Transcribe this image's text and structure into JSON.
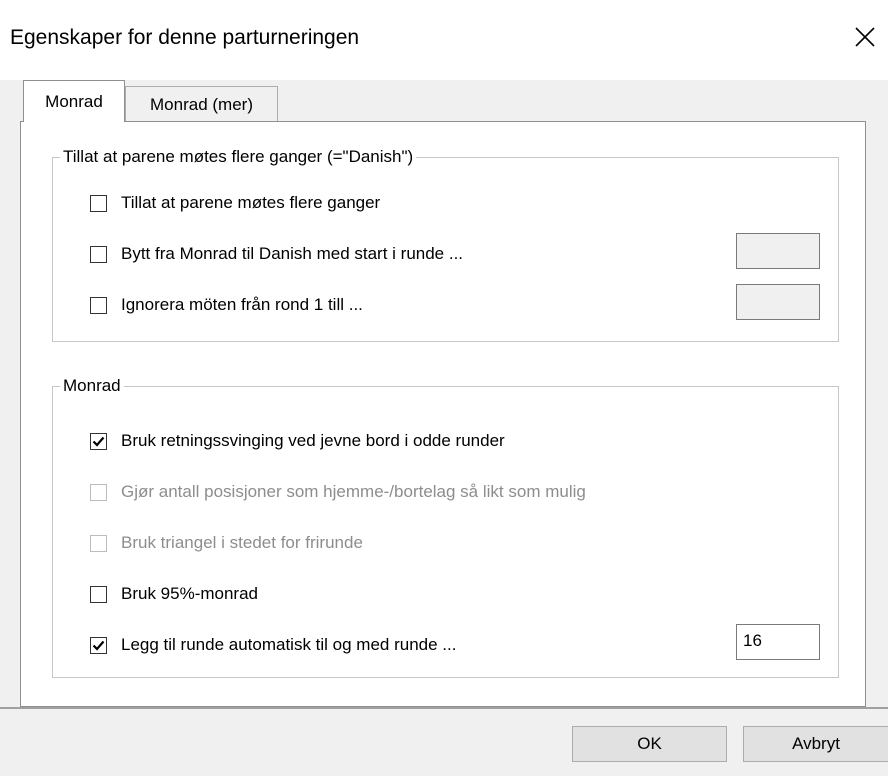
{
  "window": {
    "title": "Egenskaper for denne parturneringen",
    "close_glyph": "✕"
  },
  "tabs": [
    {
      "label": "Monrad",
      "active": true
    },
    {
      "label": "Monrad (mer)",
      "active": false
    }
  ],
  "group_danish": {
    "legend": "Tillat at parene møtes flere ganger (=\"Danish\")",
    "items": [
      {
        "label": "Tillat at parene møtes flere ganger",
        "checked": false,
        "enabled": true
      },
      {
        "label": "Bytt fra Monrad til Danish med start i runde ...",
        "checked": false,
        "enabled": true,
        "value": ""
      },
      {
        "label": "Ignorera möten från rond 1 till ...",
        "checked": false,
        "enabled": true,
        "value": ""
      }
    ]
  },
  "group_monrad": {
    "legend": "Monrad",
    "items": [
      {
        "label": "Bruk retningssvinging ved jevne bord i odde runder",
        "checked": true,
        "enabled": true
      },
      {
        "label": "Gjør antall posisjoner som hjemme-/bortelag så likt som mulig",
        "checked": false,
        "enabled": false
      },
      {
        "label": "Bruk triangel i stedet for frirunde",
        "checked": false,
        "enabled": false
      },
      {
        "label": "Bruk 95%-monrad",
        "checked": false,
        "enabled": true
      },
      {
        "label": "Legg til runde automatisk til og med runde ...",
        "checked": true,
        "enabled": true,
        "value": "16"
      }
    ]
  },
  "buttons": {
    "ok": "OK",
    "cancel": "Avbryt"
  }
}
